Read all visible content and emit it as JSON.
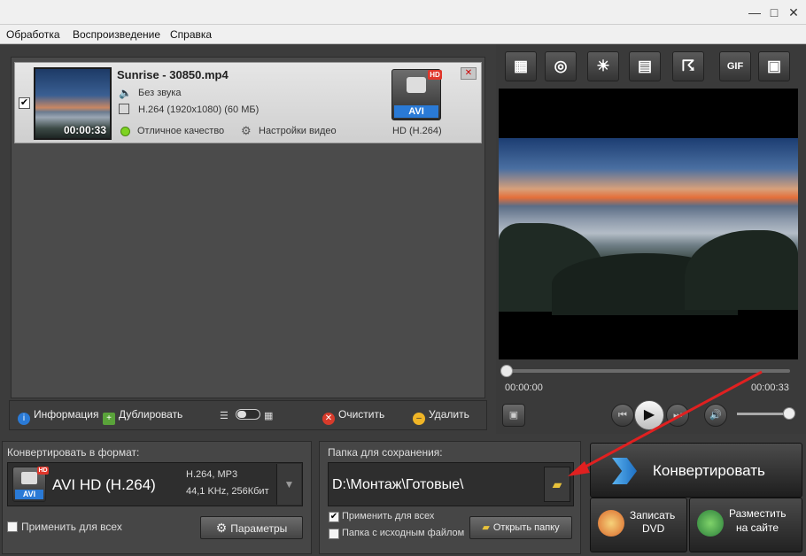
{
  "menu": {
    "items": [
      "Обработка",
      "Воспроизведение",
      "Справка"
    ]
  },
  "file": {
    "name": "Sunrise - 30850.mp4",
    "duration": "00:00:33",
    "audio": "Без звука",
    "video_info": "H.264 (1920x1080) (60 МБ)",
    "quality": "Отличное качество",
    "settings": "Настройки видео",
    "format_badge": "AVI",
    "hd_badge": "HD",
    "format_codec": "HD (H.264)",
    "checked": true
  },
  "preview": {
    "tools": [
      "crop-icon",
      "effects-icon",
      "brightness-icon",
      "trim-icon",
      "speed-icon",
      "gif-icon",
      "fullscreen-icon"
    ],
    "gif_label": "GIF",
    "time_start": "00:00:00",
    "time_end": "00:00:33",
    "progress": 0,
    "volume": 1.0
  },
  "list_toolbar": {
    "info": "Информация",
    "duplicate": "Дублировать",
    "clear": "Очистить",
    "delete": "Удалить"
  },
  "format_panel": {
    "label": "Конвертировать в формат:",
    "format_name": "AVI HD (H.264)",
    "badge": "AVI",
    "hd": "HD",
    "codec_line1": "H.264, MP3",
    "codec_line2": "44,1 KHz, 256Кбит",
    "apply_all": "Применить для всех",
    "params": "Параметры"
  },
  "folder_panel": {
    "label": "Папка для сохранения:",
    "path": "D:\\Монтаж\\Готовые\\",
    "apply_all": "Применить для всех",
    "apply_all_checked": true,
    "source_folder": "Папка с исходным файлом",
    "source_folder_checked": false,
    "open_folder": "Открыть папку"
  },
  "actions": {
    "convert": "Конвертировать",
    "burn_line1": "Записать",
    "burn_line2": "DVD",
    "publish_line1": "Разместить",
    "publish_line2": "на сайте"
  },
  "colors": {
    "accent_red": "#e0362b",
    "quality_green": "#7ed321",
    "annotation_arrow": "#e02020"
  }
}
